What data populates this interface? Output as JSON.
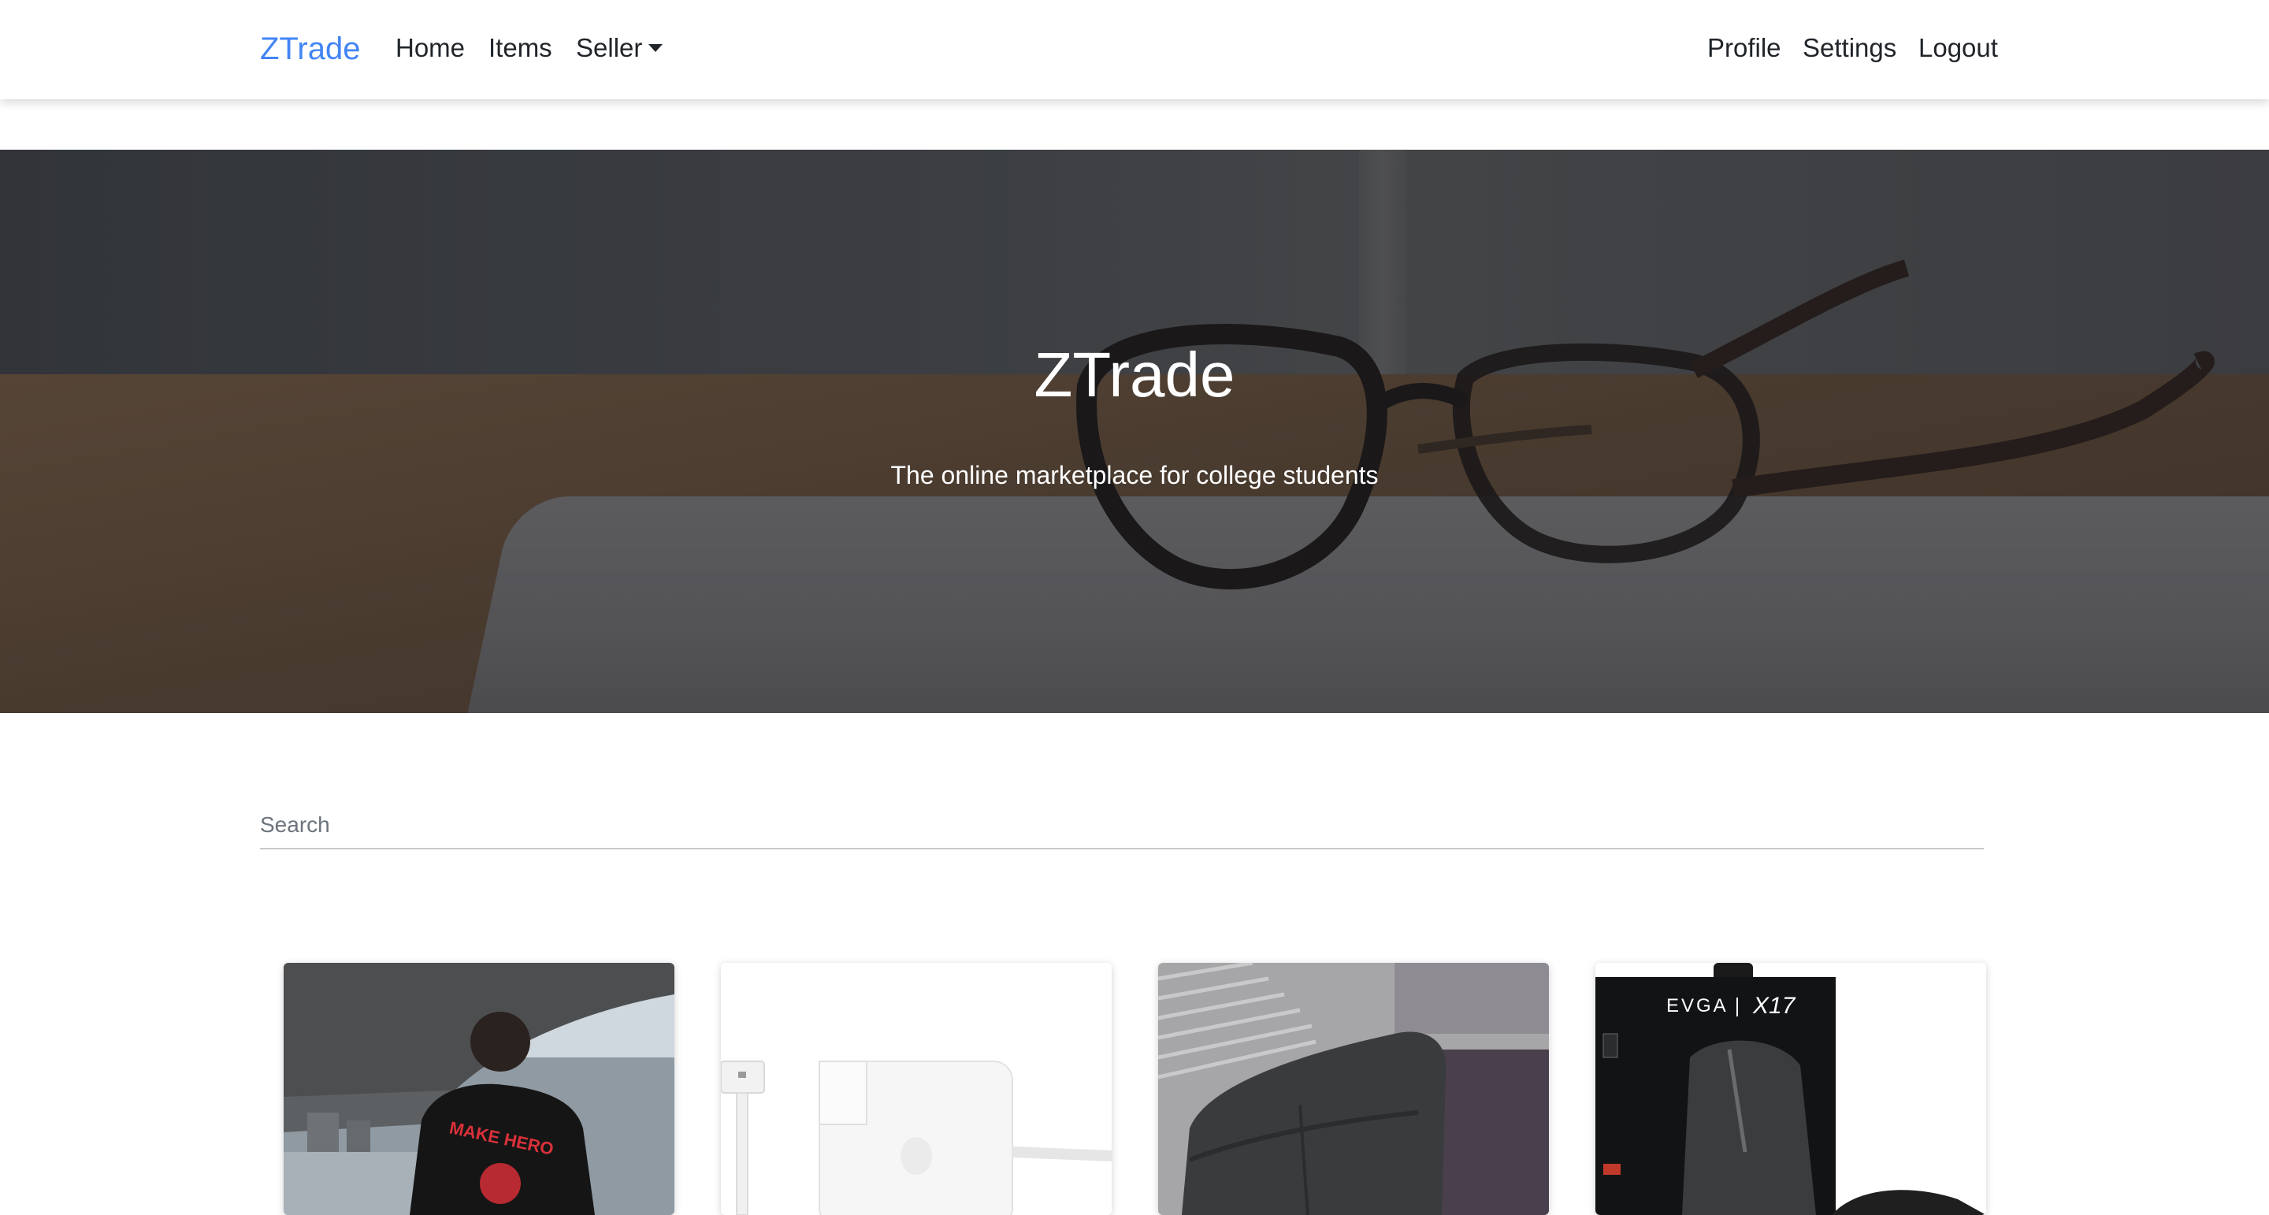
{
  "navbar": {
    "brand": "ZTrade",
    "links": {
      "home": "Home",
      "items": "Items",
      "seller": "Seller",
      "profile": "Profile",
      "settings": "Settings",
      "logout": "Logout"
    }
  },
  "hero": {
    "title": "ZTrade",
    "subtitle": "The online marketplace for college students"
  },
  "search": {
    "placeholder": "Search"
  },
  "items": [
    {
      "image": "tshirt-photo",
      "shirt_print": "MAKE HERO"
    },
    {
      "image": "charger-photo"
    },
    {
      "image": "couch-photo"
    },
    {
      "image": "mouse-box-photo",
      "box_text": [
        "EVGA",
        "X17"
      ]
    }
  ],
  "colors": {
    "brand": "#4285f4",
    "nav_text": "#212529",
    "hero_text": "#ffffff"
  }
}
